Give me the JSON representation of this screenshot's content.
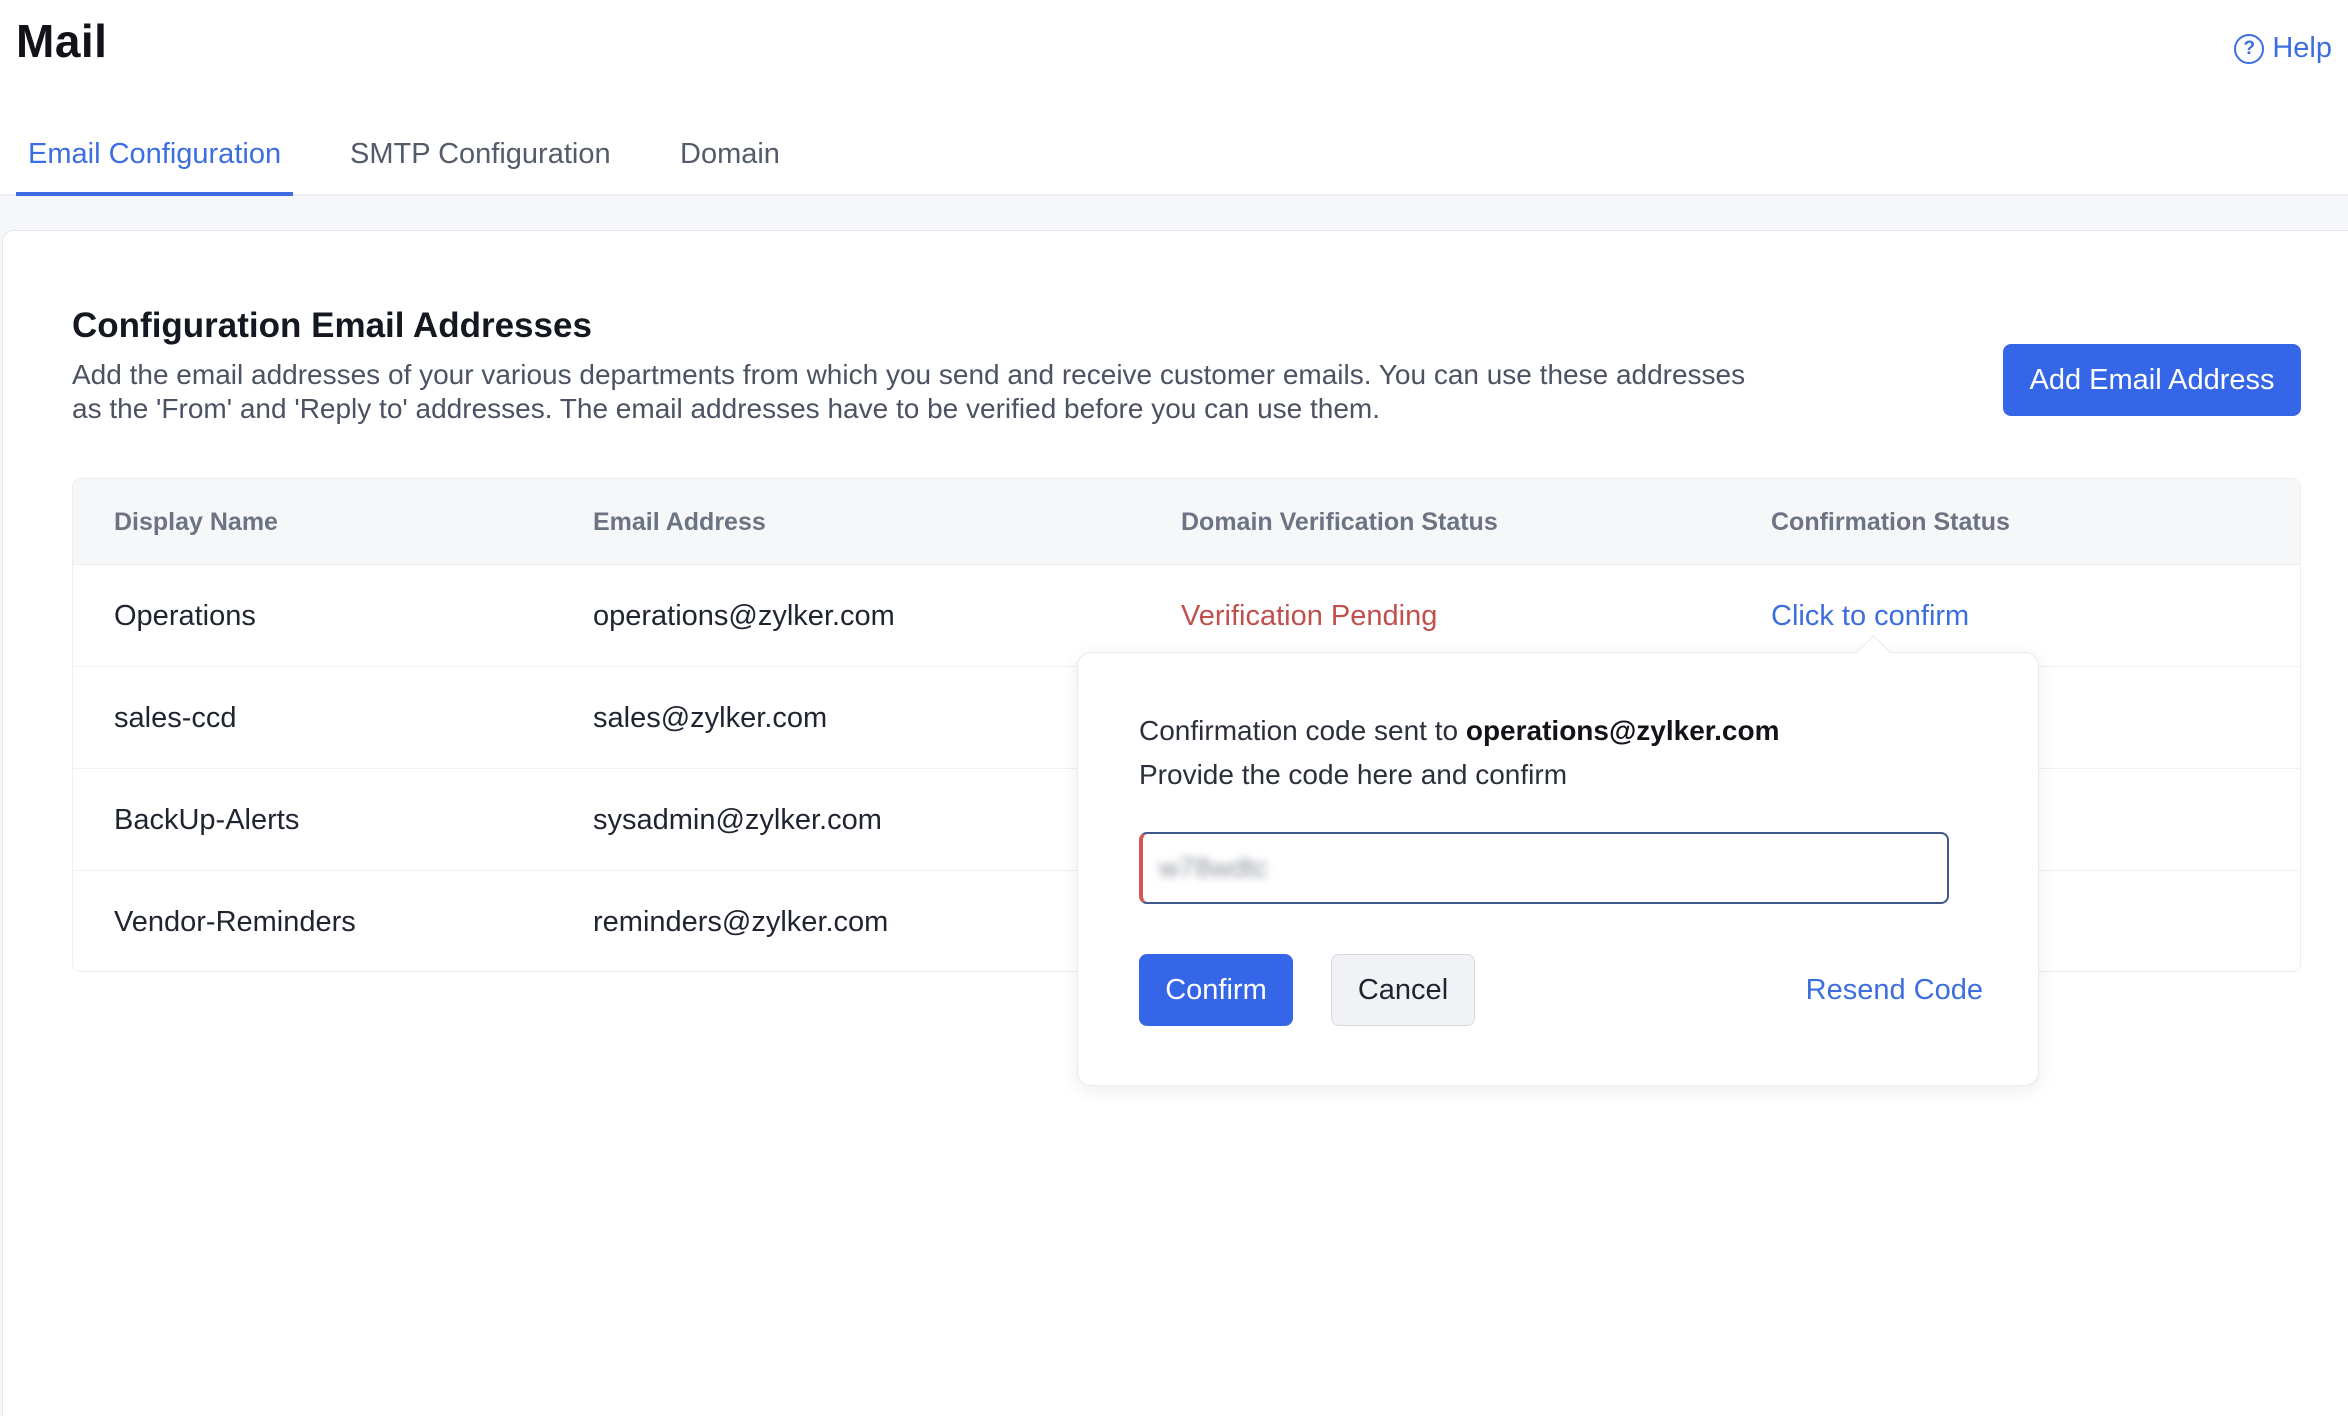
{
  "app": {
    "title": "Mail"
  },
  "header": {
    "help_label": "Help",
    "help_icon_glyph": "?"
  },
  "tabs": [
    {
      "label": "Email Configuration",
      "active": true
    },
    {
      "label": "SMTP Configuration",
      "active": false
    },
    {
      "label": "Domain",
      "active": false
    }
  ],
  "section": {
    "title": "Configuration Email Addresses",
    "description": "Add the email addresses of your various departments from which you send and receive customer emails. You can use these addresses as the 'From' and 'Reply to' addresses. The email addresses have to be verified before you can use them.",
    "add_button_label": "Add Email Address"
  },
  "table": {
    "columns": [
      "Display Name",
      "Email Address",
      "Domain Verification Status",
      "Confirmation Status"
    ],
    "rows": [
      {
        "display_name": "Operations",
        "email": "operations@zylker.com",
        "domain_status": "Verification Pending",
        "confirmation": "Click to confirm"
      },
      {
        "display_name": "sales-ccd",
        "email": "sales@zylker.com",
        "domain_status": "",
        "confirmation": ""
      },
      {
        "display_name": "BackUp-Alerts",
        "email": "sysadmin@zylker.com",
        "domain_status": "",
        "confirmation": ""
      },
      {
        "display_name": "Vendor-Reminders",
        "email": "reminders@zylker.com",
        "domain_status": "",
        "confirmation": ""
      }
    ]
  },
  "popover": {
    "line1_prefix": "Confirmation code sent to",
    "line1_email": "operations@zylker.com",
    "line2": "Provide the code here and confirm",
    "code_value": "w78wdtc",
    "confirm_label": "Confirm",
    "cancel_label": "Cancel",
    "resend_label": "Resend Code"
  },
  "colors": {
    "accent": "#3566e8",
    "link": "#3d6ee0",
    "pending": "#c0504d"
  }
}
